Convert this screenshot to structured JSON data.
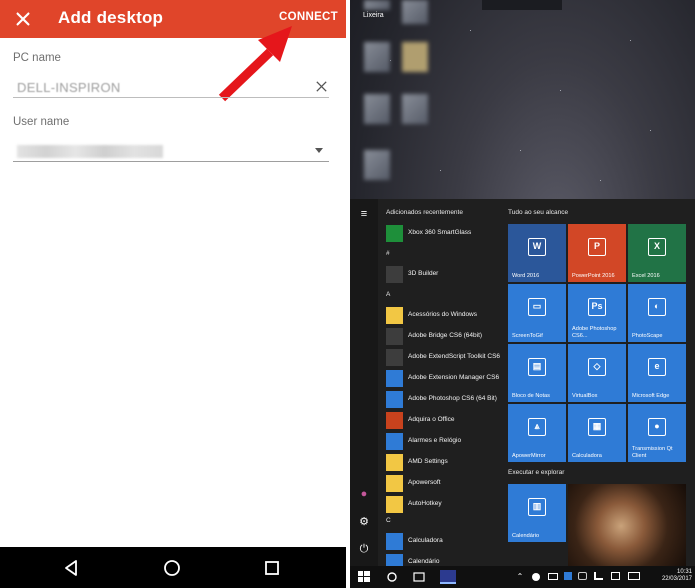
{
  "app": {
    "title": "Add desktop",
    "connect_label": "CONNECT",
    "pc_name_label": "PC name",
    "pc_name_value": "DELL-INSPIRON",
    "user_name_label": "User name"
  },
  "android_nav": {
    "icons": [
      "back-icon",
      "home-icon",
      "recents-icon"
    ]
  },
  "desktop": {
    "recycle_label": "Lixeira"
  },
  "start_menu": {
    "recent_header": "Adicionados recentemente",
    "tiles_header": "Tudo ao seu alcance",
    "explore_header": "Executar e explorar",
    "sections": [
      "#",
      "A",
      "C"
    ],
    "apps": [
      {
        "name": "Xbox 360 SmartGlass",
        "color": "green"
      },
      {
        "name": "3D Builder",
        "color": "dark"
      },
      {
        "name": "Acessórios do Windows",
        "color": "yellow"
      },
      {
        "name": "Adobe Bridge CS6 (64bit)",
        "color": "dark"
      },
      {
        "name": "Adobe ExtendScript Toolkit CS6",
        "color": "dark"
      },
      {
        "name": "Adobe Extension Manager CS6",
        "color": "blue"
      },
      {
        "name": "Adobe Photoshop CS6 (64 Bit)",
        "color": "blue"
      },
      {
        "name": "Adquira o Office",
        "color": "red"
      },
      {
        "name": "Alarmes e Relógio",
        "color": "blue"
      },
      {
        "name": "AMD Settings",
        "color": "yellow"
      },
      {
        "name": "Apowersoft",
        "color": "yellow"
      },
      {
        "name": "AutoHotkey",
        "color": "yellow"
      },
      {
        "name": "Calculadora",
        "color": "blue"
      },
      {
        "name": "Calendário",
        "color": "blue"
      }
    ],
    "tiles": [
      {
        "label": "Word 2016",
        "glyph": "W",
        "color": "#2b579a"
      },
      {
        "label": "PowerPoint 2016",
        "glyph": "P",
        "color": "#d24726"
      },
      {
        "label": "Excel 2016",
        "glyph": "X",
        "color": "#217346"
      },
      {
        "label": "ScreenToGif",
        "glyph": "▭",
        "color": "#2f7bd6"
      },
      {
        "label": "Adobe Photoshop CS6...",
        "glyph": "Ps",
        "color": "#2f7bd6"
      },
      {
        "label": "PhotoScape",
        "glyph": "◐",
        "color": "#2f7bd6"
      },
      {
        "label": "Bloco de Notas",
        "glyph": "▤",
        "color": "#2f7bd6"
      },
      {
        "label": "VirtualBox",
        "glyph": "◇",
        "color": "#2f7bd6"
      },
      {
        "label": "Microsoft Edge",
        "glyph": "e",
        "color": "#2f7bd6"
      },
      {
        "label": "ApowerMirror",
        "glyph": "⩓",
        "color": "#2f7bd6"
      },
      {
        "label": "Calculadora",
        "glyph": "▦",
        "color": "#2f7bd6"
      },
      {
        "label": "Transmission Qt Client",
        "glyph": "●",
        "color": "#2f7bd6"
      },
      {
        "label": "Calendário",
        "glyph": "▥",
        "color": "#2f7bd6"
      }
    ]
  },
  "taskbar": {
    "time": "10:31",
    "date": "22/03/2017"
  }
}
